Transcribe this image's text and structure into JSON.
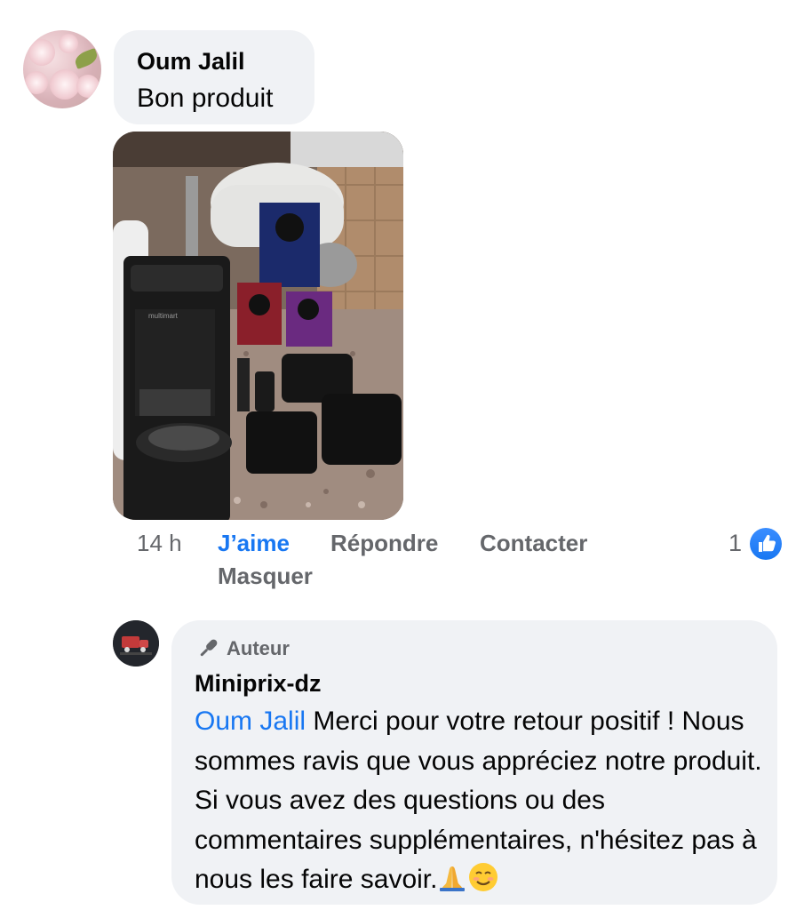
{
  "comment": {
    "author": "Oum Jalil",
    "text": "Bon produit",
    "time": "14 h",
    "actions": {
      "like": "J’aime",
      "reply": "Répondre",
      "contact": "Contacter",
      "hide": "Masquer"
    },
    "reaction_count": "1",
    "reaction_icon": "like-thumbs-up-icon"
  },
  "reply": {
    "badge": "Auteur",
    "author": "Miniprix-dz",
    "mention": "Oum Jalil",
    "text": " Merci pour votre retour positif ! Nous sommes ravis que vous appréciez notre produit. Si vous avez des questions ou des commentaires supplémentaires, n'hésitez pas à nous les faire savoir.",
    "emojis": [
      "🙏",
      "☺️"
    ]
  },
  "colors": {
    "bubble": "#f0f2f5",
    "link": "#1877f2",
    "muted": "#65676b",
    "text": "#050505"
  }
}
